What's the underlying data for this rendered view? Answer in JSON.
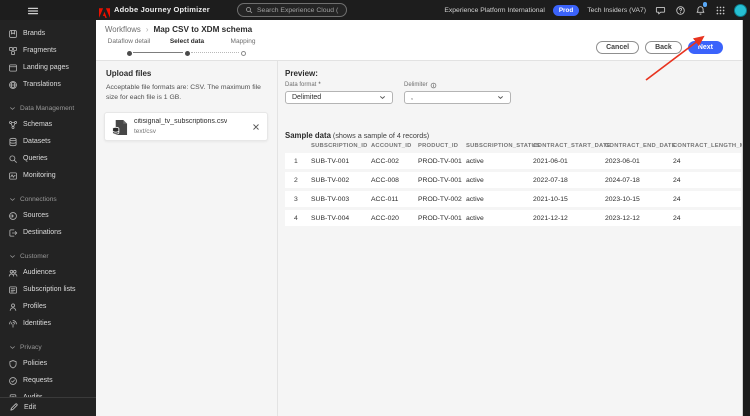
{
  "topbar": {
    "app_title": "Adobe Journey Optimizer",
    "search_placeholder": "Search Experience Cloud (⌘+/)",
    "org_name": "Experience Platform International",
    "env_badge": "Prod",
    "sandbox_name": "Tech Insiders (VA7)"
  },
  "sidebar": {
    "items": [
      {
        "type": "item",
        "label": "Brands",
        "icon": "brands-icon"
      },
      {
        "type": "item",
        "label": "Fragments",
        "icon": "fragments-icon"
      },
      {
        "type": "item",
        "label": "Landing pages",
        "icon": "landing-pages-icon"
      },
      {
        "type": "item",
        "label": "Translations",
        "icon": "translations-icon"
      },
      {
        "type": "section",
        "label": "Data Management"
      },
      {
        "type": "item",
        "label": "Schemas",
        "icon": "schemas-icon"
      },
      {
        "type": "item",
        "label": "Datasets",
        "icon": "datasets-icon"
      },
      {
        "type": "item",
        "label": "Queries",
        "icon": "queries-icon"
      },
      {
        "type": "item",
        "label": "Monitoring",
        "icon": "monitoring-icon"
      },
      {
        "type": "section",
        "label": "Connections"
      },
      {
        "type": "item",
        "label": "Sources",
        "icon": "sources-icon"
      },
      {
        "type": "item",
        "label": "Destinations",
        "icon": "destinations-icon"
      },
      {
        "type": "section",
        "label": "Customer"
      },
      {
        "type": "item",
        "label": "Audiences",
        "icon": "audiences-icon"
      },
      {
        "type": "item",
        "label": "Subscription lists",
        "icon": "subscription-lists-icon"
      },
      {
        "type": "item",
        "label": "Profiles",
        "icon": "profiles-icon"
      },
      {
        "type": "item",
        "label": "Identities",
        "icon": "identities-icon"
      },
      {
        "type": "section",
        "label": "Privacy"
      },
      {
        "type": "item",
        "label": "Policies",
        "icon": "policies-icon"
      },
      {
        "type": "item",
        "label": "Requests",
        "icon": "requests-icon"
      },
      {
        "type": "item",
        "label": "Audits",
        "icon": "audits-icon"
      }
    ],
    "edit_label": "Edit"
  },
  "workflow_header": {
    "breadcrumb_root": "Workflows",
    "breadcrumb_current": "Map CSV to XDM schema",
    "steps": [
      {
        "label": "Dataflow detail",
        "state": "complete"
      },
      {
        "label": "Select data",
        "state": "current"
      },
      {
        "label": "Mapping",
        "state": "upcoming"
      }
    ],
    "cancel_label": "Cancel",
    "back_label": "Back",
    "next_label": "Next"
  },
  "upload": {
    "title": "Upload files",
    "description": "Acceptable file formats are: CSV. The maximum file size for each file is 1 GB.",
    "file": {
      "name": "citisignal_tv_subscriptions.csv",
      "type": "text/csv"
    }
  },
  "preview": {
    "title": "Preview:",
    "data_format_label": "Data format",
    "required_marker": "*",
    "data_format_value": "Delimited",
    "delimiter_label": "Delimiter",
    "delimiter_value": ","
  },
  "sample": {
    "title": "Sample data",
    "subtitle": " (shows a sample of 4 records)",
    "columns": [
      "",
      "SUBSCRIPTION_ID",
      "ACCOUNT_ID",
      "PRODUCT_ID",
      "SUBSCRIPTION_STATUS",
      "CONTRACT_START_DATE",
      "CONTRACT_END_DATE",
      "CONTRACT_LENGTH_MONTHS"
    ],
    "rows": [
      [
        "1",
        "SUB-TV-001",
        "ACC-002",
        "PROD-TV-001",
        "active",
        "2021-06-01",
        "2023-06-01",
        "24"
      ],
      [
        "2",
        "SUB-TV-002",
        "ACC-008",
        "PROD-TV-001",
        "active",
        "2022-07-18",
        "2024-07-18",
        "24"
      ],
      [
        "3",
        "SUB-TV-003",
        "ACC-011",
        "PROD-TV-002",
        "active",
        "2021-10-15",
        "2023-10-15",
        "24"
      ],
      [
        "4",
        "SUB-TV-004",
        "ACC-020",
        "PROD-TV-001",
        "active",
        "2021-12-12",
        "2023-12-12",
        "24"
      ]
    ]
  },
  "colors": {
    "accent_blue": "#3b63fb",
    "annotation_red": "#e8331f",
    "avatar_teal": "#26c0d3"
  },
  "annotation": {
    "type": "arrow",
    "points_to": "next-button"
  }
}
